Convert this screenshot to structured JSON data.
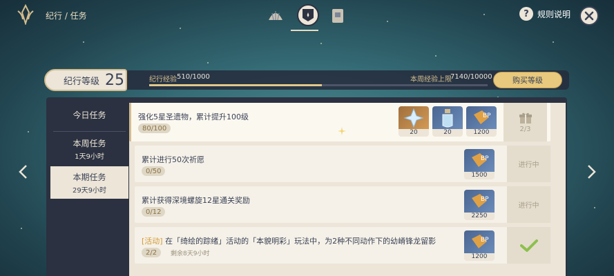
{
  "header": {
    "breadcrumb": "纪行 / 任务",
    "tabs": [
      {
        "name": "rewards",
        "icon": "shell-icon",
        "active": false
      },
      {
        "name": "missions",
        "icon": "mission-badge-icon",
        "active": true
      },
      {
        "name": "shop",
        "icon": "gift-card-icon",
        "active": false
      }
    ],
    "rules_label": "规则说明"
  },
  "level": {
    "label": "纪行等级",
    "value": "25",
    "exp_label": "纪行经验",
    "exp_value": "510/1000",
    "exp_progress": 0.51,
    "weekly_label": "本周经验上限",
    "weekly_value": "7140/10000",
    "buy_label": "购买等级"
  },
  "sidebar": {
    "tabs": [
      {
        "title": "今日任务",
        "sub": ""
      },
      {
        "title": "本周任务",
        "sub": "1天9小时"
      },
      {
        "title": "本期任务",
        "sub": "29天9小时"
      }
    ],
    "active_index": 2
  },
  "tasks": [
    {
      "title": "强化5星圣遗物，累计提升100级",
      "progress": "80/100",
      "rewards": [
        {
          "icon": "crystal-star-icon",
          "qty": "20",
          "style": "gold"
        },
        {
          "icon": "potion-bottle-icon",
          "qty": "20",
          "style": "blue"
        },
        {
          "icon": "bp-exp-icon",
          "qty": "1200",
          "style": "blue"
        }
      ],
      "status_icon": "gift-box-icon",
      "status": "2/3"
    },
    {
      "title": "累计进行50次祈愿",
      "progress": "0/50",
      "rewards": [
        {
          "icon": "bp-exp-icon",
          "qty": "1500",
          "style": "blue"
        }
      ],
      "status": "进行中"
    },
    {
      "title": "累计获得深境螺旋12星通关奖励",
      "progress": "0/12",
      "rewards": [
        {
          "icon": "bp-exp-icon",
          "qty": "2250",
          "style": "blue"
        }
      ],
      "status": "进行中"
    },
    {
      "tag": "[活动]",
      "title": "在「绮绘的踪绪」活动的「本貌明彩」玩法中，为2种不同动作下的幼嵴锋龙留影",
      "progress": "2/2",
      "remaining": "剩余8天9小时",
      "rewards": [
        {
          "icon": "bp-exp-icon",
          "qty": "1200",
          "style": "blue"
        }
      ],
      "status_icon": "checkmark-icon"
    }
  ]
}
